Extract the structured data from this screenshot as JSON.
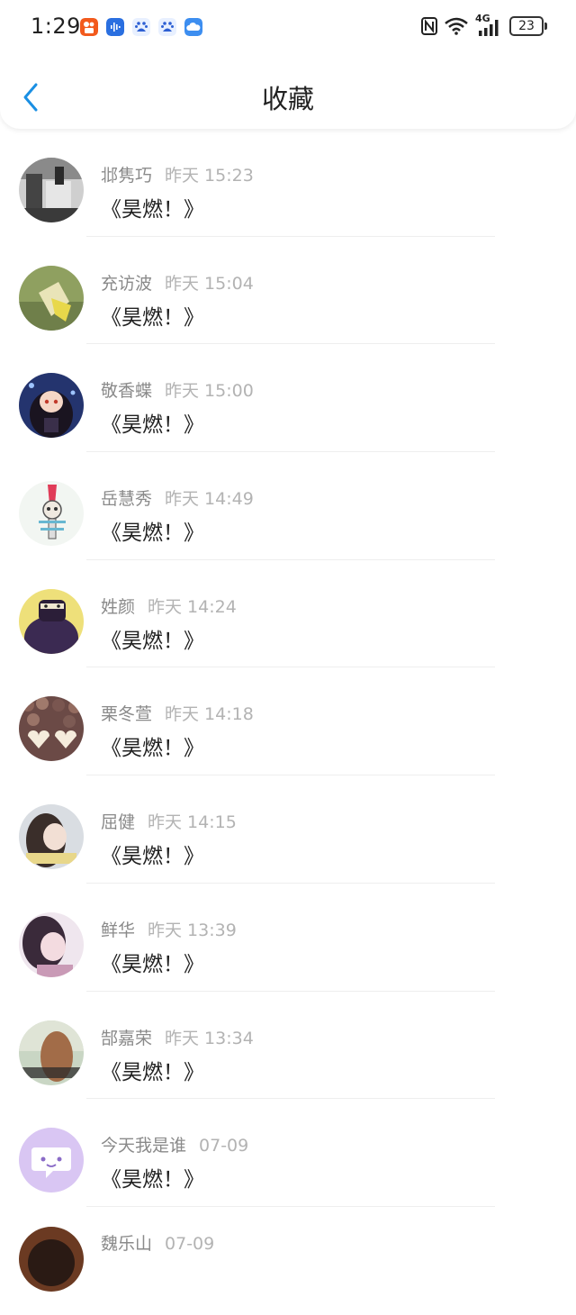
{
  "status_bar": {
    "time": "1:29",
    "network": "4G",
    "battery": "23"
  },
  "header": {
    "title": "收藏"
  },
  "items": [
    {
      "name": "邶隽巧",
      "time": "昨天 15:23",
      "message": "《昊燃！》"
    },
    {
      "name": "充访波",
      "time": "昨天 15:04",
      "message": "《昊燃！》"
    },
    {
      "name": "敬香蝶",
      "time": "昨天 15:00",
      "message": "《昊燃！》"
    },
    {
      "name": "岳慧秀",
      "time": "昨天 14:49",
      "message": "《昊燃！》"
    },
    {
      "name": "姓颜",
      "time": "昨天 14:24",
      "message": "《昊燃！》"
    },
    {
      "name": "栗冬萱",
      "time": "昨天 14:18",
      "message": "《昊燃！》"
    },
    {
      "name": "屈健",
      "time": "昨天 14:15",
      "message": "《昊燃！》"
    },
    {
      "name": "鲜华",
      "time": "昨天 13:39",
      "message": "《昊燃！》"
    },
    {
      "name": "郜嘉荣",
      "time": "昨天 13:34",
      "message": "《昊燃！》"
    },
    {
      "name": "今天我是谁",
      "time": "07-09",
      "message": "《昊燃！》"
    },
    {
      "name": "魏乐山",
      "time": "07-09",
      "message": ""
    }
  ],
  "colors": {
    "accent": "#1a8fe3",
    "text_primary": "#222222",
    "text_secondary": "#8a8a8a"
  }
}
